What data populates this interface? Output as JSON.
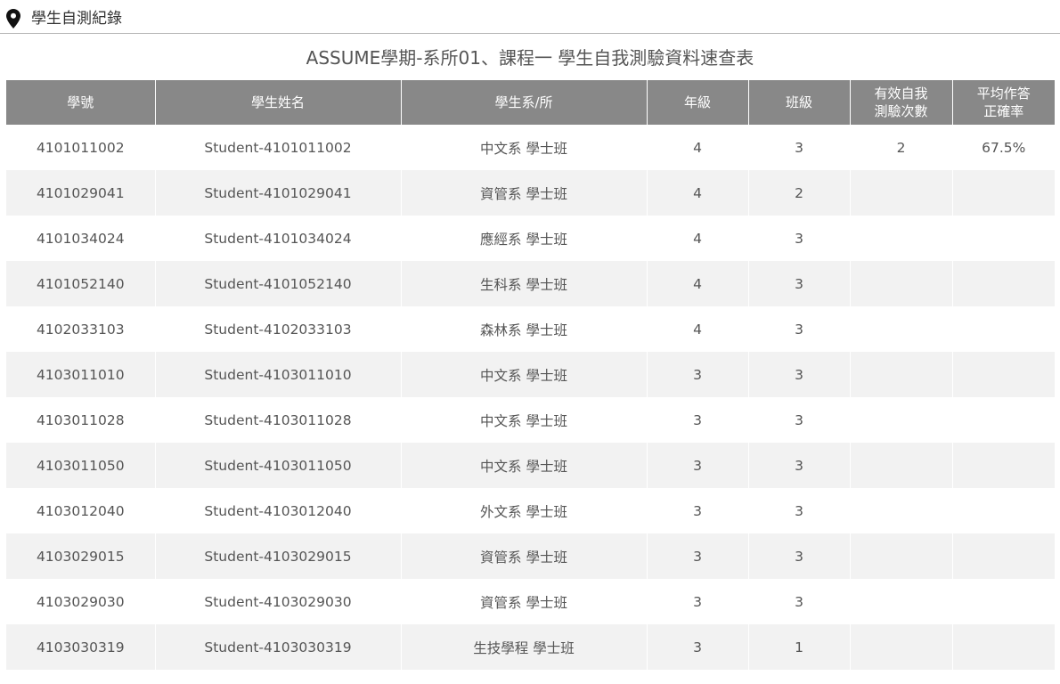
{
  "breadcrumb": {
    "icon": "map-pin-icon",
    "label": "學生自測紀錄"
  },
  "title": "ASSUME學期-系所01、課程一 學生自我測驗資料速查表",
  "columns": [
    "學號",
    "學生姓名",
    "學生系/所",
    "年級",
    "班級",
    "有效自我\n測驗次數",
    "平均作答\n正確率"
  ],
  "rows": [
    {
      "id": "4101011002",
      "name": "Student-4101011002",
      "dept": "中文系 學士班",
      "grade": "4",
      "class": "3",
      "tests": "2",
      "accuracy": "67.5%"
    },
    {
      "id": "4101029041",
      "name": "Student-4101029041",
      "dept": "資管系 學士班",
      "grade": "4",
      "class": "2",
      "tests": "",
      "accuracy": ""
    },
    {
      "id": "4101034024",
      "name": "Student-4101034024",
      "dept": "應經系 學士班",
      "grade": "4",
      "class": "3",
      "tests": "",
      "accuracy": ""
    },
    {
      "id": "4101052140",
      "name": "Student-4101052140",
      "dept": "生科系 學士班",
      "grade": "4",
      "class": "3",
      "tests": "",
      "accuracy": ""
    },
    {
      "id": "4102033103",
      "name": "Student-4102033103",
      "dept": "森林系 學士班",
      "grade": "4",
      "class": "3",
      "tests": "",
      "accuracy": ""
    },
    {
      "id": "4103011010",
      "name": "Student-4103011010",
      "dept": "中文系 學士班",
      "grade": "3",
      "class": "3",
      "tests": "",
      "accuracy": ""
    },
    {
      "id": "4103011028",
      "name": "Student-4103011028",
      "dept": "中文系 學士班",
      "grade": "3",
      "class": "3",
      "tests": "",
      "accuracy": ""
    },
    {
      "id": "4103011050",
      "name": "Student-4103011050",
      "dept": "中文系 學士班",
      "grade": "3",
      "class": "3",
      "tests": "",
      "accuracy": ""
    },
    {
      "id": "4103012040",
      "name": "Student-4103012040",
      "dept": "外文系 學士班",
      "grade": "3",
      "class": "3",
      "tests": "",
      "accuracy": ""
    },
    {
      "id": "4103029015",
      "name": "Student-4103029015",
      "dept": "資管系 學士班",
      "grade": "3",
      "class": "3",
      "tests": "",
      "accuracy": ""
    },
    {
      "id": "4103029030",
      "name": "Student-4103029030",
      "dept": "資管系 學士班",
      "grade": "3",
      "class": "3",
      "tests": "",
      "accuracy": ""
    },
    {
      "id": "4103030319",
      "name": "Student-4103030319",
      "dept": "生技學程 學士班",
      "grade": "3",
      "class": "1",
      "tests": "",
      "accuracy": ""
    }
  ],
  "colors": {
    "header_bg": "#888888",
    "stripe_bg": "#f2f2f2",
    "text": "#555555"
  }
}
